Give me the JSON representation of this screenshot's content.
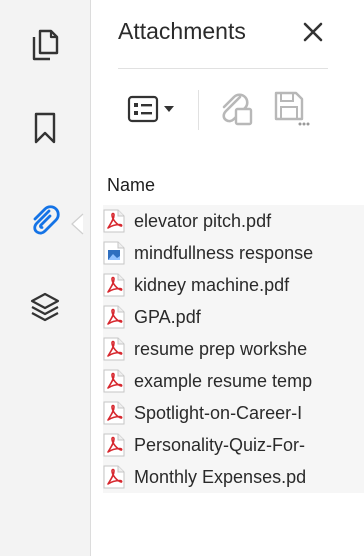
{
  "rail": {
    "items": [
      {
        "icon": "copy-pages-icon",
        "active": false
      },
      {
        "icon": "bookmark-icon",
        "active": false
      },
      {
        "icon": "paperclip-icon",
        "active": true
      },
      {
        "icon": "layers-icon",
        "active": false
      }
    ],
    "accent_color": "#1473e6"
  },
  "panel": {
    "title": "Attachments",
    "close_glyph": "✕",
    "toolbar": {
      "options": {
        "icon": "options-list-icon",
        "caret_icon": "caret-down-icon"
      },
      "add": {
        "icon": "add-attachment-icon",
        "enabled": false
      },
      "save": {
        "icon": "save-attachment-icon",
        "enabled": false
      }
    },
    "column_header": "Name",
    "files": [
      {
        "name": "elevator pitch.pdf",
        "type": "pdf"
      },
      {
        "name": "mindfullness response",
        "type": "image"
      },
      {
        "name": "kidney machine.pdf",
        "type": "pdf"
      },
      {
        "name": "GPA.pdf",
        "type": "pdf"
      },
      {
        "name": "resume prep workshe",
        "type": "pdf"
      },
      {
        "name": "example resume temp",
        "type": "pdf"
      },
      {
        "name": "Spotlight-on-Career-I",
        "type": "pdf"
      },
      {
        "name": "Personality-Quiz-For-",
        "type": "pdf"
      },
      {
        "name": "Monthly Expenses.pd",
        "type": "pdf"
      }
    ]
  },
  "colors": {
    "pdf_red": "#d7282f",
    "image_blue": "#2f6fc0",
    "disabled_gray": "#b8b8b8"
  }
}
